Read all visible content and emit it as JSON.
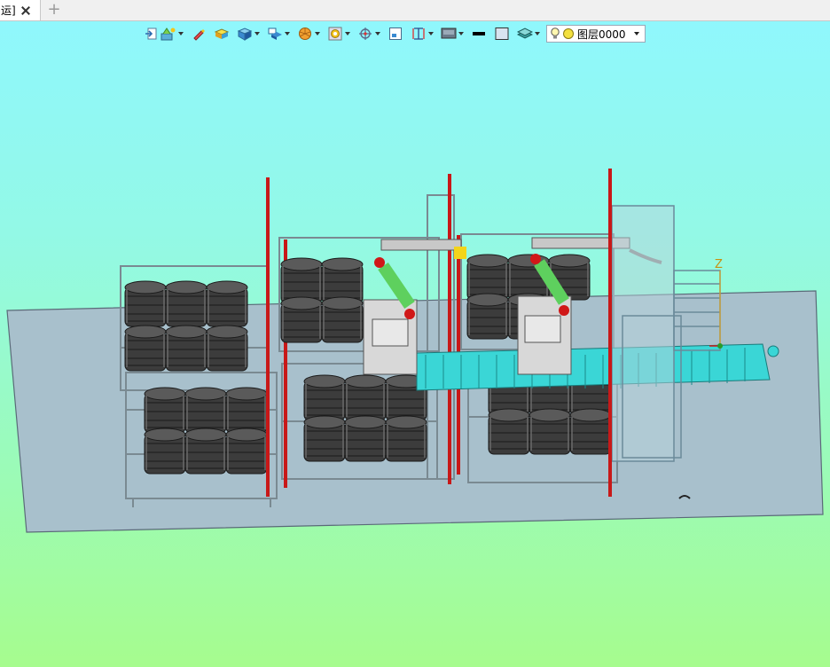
{
  "tab": {
    "title": "运]",
    "close_icon": "close-icon",
    "add_icon": "plus-icon",
    "add_label": "+"
  },
  "toolbar": {
    "items": [
      "import-icon",
      "scene-icon",
      "paint-icon",
      "block-icon",
      "cube-icon",
      "view-icon",
      "pie-icon",
      "cylinder-icon",
      "target-icon",
      "frame-icon",
      "dimension-icon",
      "display-icon",
      "line-color-icon",
      "fill-color-icon",
      "layers-icon"
    ],
    "layer_select": {
      "value": "图层0000",
      "icons": [
        "bulb-icon",
        "sun-icon"
      ]
    }
  },
  "viewport": {
    "axis_label": "Z",
    "colors": {
      "floor": "#a8c0cc",
      "frame": "#7a8a92",
      "barrel": "#3c3c3c",
      "conveyor": "#3ad6d6",
      "robot_arm": "#c8c8c8",
      "robot_joint": "#d01818",
      "robot_link": "#5ed05e",
      "post": "#c81818"
    }
  }
}
